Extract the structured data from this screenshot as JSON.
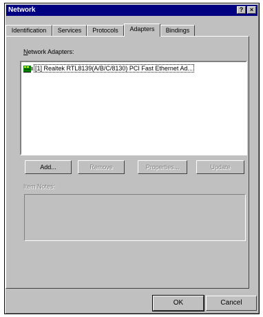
{
  "window": {
    "title": "Network",
    "help_glyph": "?",
    "close_glyph": "×"
  },
  "tabs": [
    {
      "label": "Identification",
      "active": false
    },
    {
      "label": "Services",
      "active": false
    },
    {
      "label": "Protocols",
      "active": false
    },
    {
      "label": "Adapters",
      "active": true
    },
    {
      "label": "Bindings",
      "active": false
    }
  ],
  "adapters": {
    "label_prefix": "N",
    "label_rest": "etwork Adapters:",
    "items": [
      {
        "text": "[1] Realtek RTL8139(A/B/C/8130) PCI Fast Ethernet Ad..."
      }
    ]
  },
  "buttons": {
    "add": "Add...",
    "remove": "Remove",
    "properties": "Properties...",
    "update": "Update"
  },
  "item_notes_label": "Item Notes:",
  "footer": {
    "ok": "OK",
    "cancel": "Cancel"
  },
  "colors": {
    "title_bar": "#000080",
    "face": "#c0c0c0"
  }
}
